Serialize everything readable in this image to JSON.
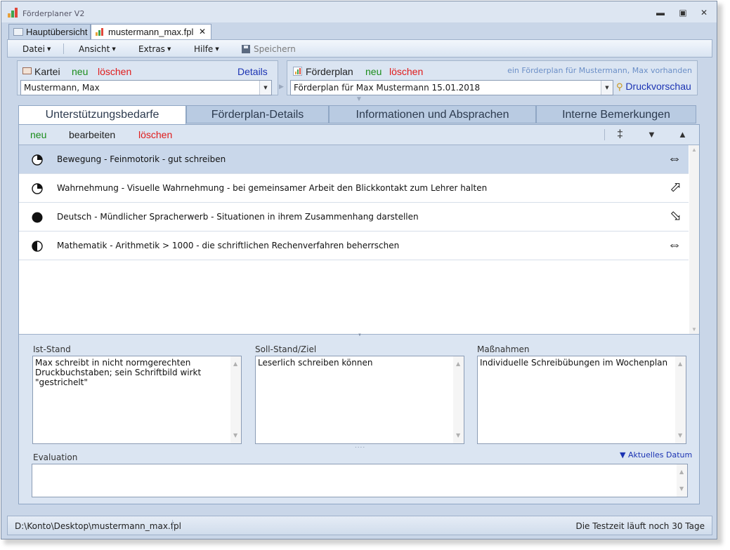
{
  "app": {
    "title": "Förderplaner V2",
    "icon": "bar-chart-icon"
  },
  "window_controls": {
    "minimize": "▬",
    "maximize": "▣",
    "close": "✕"
  },
  "doc_tabs": [
    {
      "label": "Hauptübersicht",
      "icon": "list-icon"
    },
    {
      "label": "mustermann_max.fpl",
      "icon": "bar-chart-icon",
      "close": "✕"
    }
  ],
  "menu": {
    "items": [
      "Datei",
      "Ansicht",
      "Extras",
      "Hilfe"
    ],
    "save_label": "Speichern"
  },
  "kartei": {
    "label": "Kartei",
    "new": "neu",
    "delete": "löschen",
    "details": "Details",
    "selected": "Mustermann, Max"
  },
  "foerderplan": {
    "label": "Förderplan",
    "new": "neu",
    "delete": "löschen",
    "info": "ein Förderplan für Mustermann, Max vorhanden",
    "selected": "Förderplan für Max Mustermann 15.01.2018",
    "print_preview": "Druckvorschau"
  },
  "tabs": [
    "Unterstützungsbedarfe",
    "Förderplan-Details",
    "Informationen und Absprachen",
    "Interne Bemerkungen"
  ],
  "list_toolbar": {
    "new": "neu",
    "edit": "bearbeiten",
    "delete": "löschen",
    "sort_icon": "‡",
    "down_icon": "▼",
    "up_icon": "▲"
  },
  "needs": [
    {
      "text": "Bewegung - Feinmotorik - gut schreiben",
      "status": "quarter",
      "trend": "⇔"
    },
    {
      "text": "Wahrnehmung - Visuelle Wahrnehmung - bei gemeinsamer Arbeit den Blickkontakt zum Lehrer halten",
      "status": "quarter",
      "trend": "⬀"
    },
    {
      "text": "Deutsch - Mündlicher Spracherwerb - Situationen in ihrem Zusammenhang darstellen",
      "status": "full",
      "trend": "⬂"
    },
    {
      "text": "Mathematik - Arithmetik > 1000 - die schriftlichen Rechenverfahren beherrschen",
      "status": "half",
      "trend": "⇔"
    }
  ],
  "details": {
    "ist_label": "Ist-Stand",
    "ist_value": "Max schreibt in nicht normgerechten Druckbuchstaben; sein Schriftbild wirkt \"gestrichelt\"",
    "soll_label": "Soll-Stand/Ziel",
    "soll_value": "Leserlich schreiben können",
    "mass_label": "Maßnahmen",
    "mass_value": "Individuelle Schreibübungen im Wochenplan",
    "eval_label": "Evaluation",
    "eval_value": "",
    "current_date": "▼ Aktuelles Datum"
  },
  "statusbar": {
    "path": "D:\\Konto\\Desktop\\mustermann_max.fpl",
    "trial": "Die Testzeit läuft noch 30 Tage"
  },
  "colors": {
    "green": "#1a8c1a",
    "red": "#e01b1b",
    "blue": "#1b33b3",
    "selection": "#c9d7ea"
  }
}
